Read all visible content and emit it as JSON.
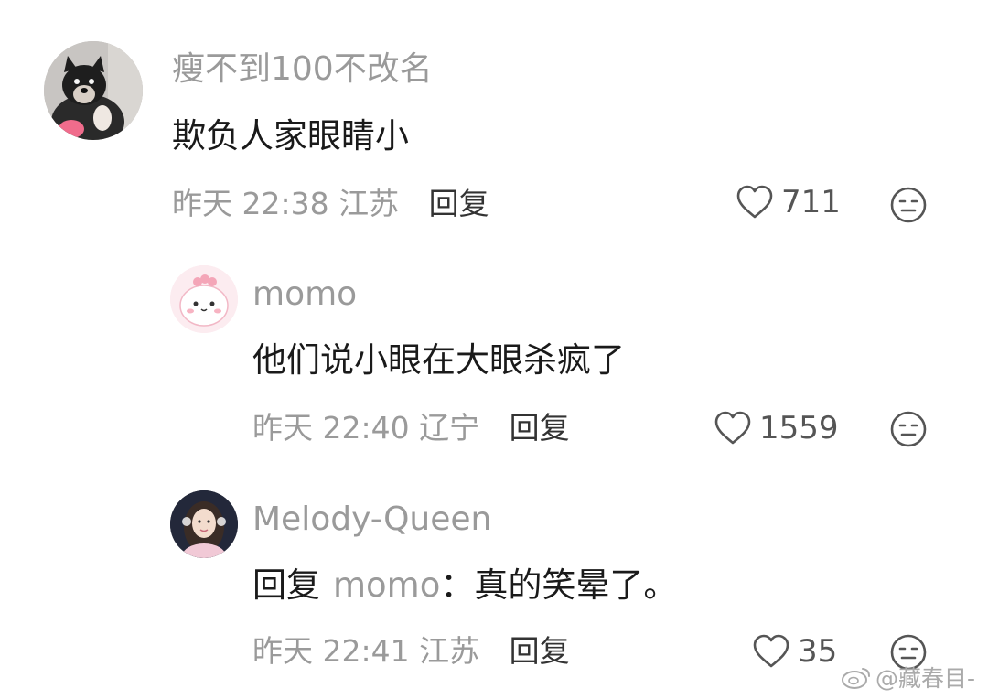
{
  "comments": [
    {
      "username": "瘦不到100不改名",
      "text": "欺负人家眼睛小",
      "time": "昨天 22:38",
      "location": "江苏",
      "reply_label": "回复",
      "likes": "711",
      "avatar": "dog-avatar"
    },
    {
      "username": "momo",
      "text": "他们说小眼在大眼杀疯了",
      "time": "昨天 22:40",
      "location": "辽宁",
      "reply_label": "回复",
      "likes": "1559",
      "avatar": "pink-dino-avatar"
    },
    {
      "username": "Melody-Queen",
      "reply_prefix": "回复",
      "reply_to": "momo",
      "text": "：真的笑晕了。",
      "time": "昨天 22:41",
      "location": "江苏",
      "reply_label": "回复",
      "likes": "35",
      "avatar": "girl-avatar"
    }
  ],
  "watermark": "@藏春目-",
  "colors": {
    "muted": "#9a9a9a",
    "text": "#1a1a1a",
    "icon": "#555555"
  }
}
